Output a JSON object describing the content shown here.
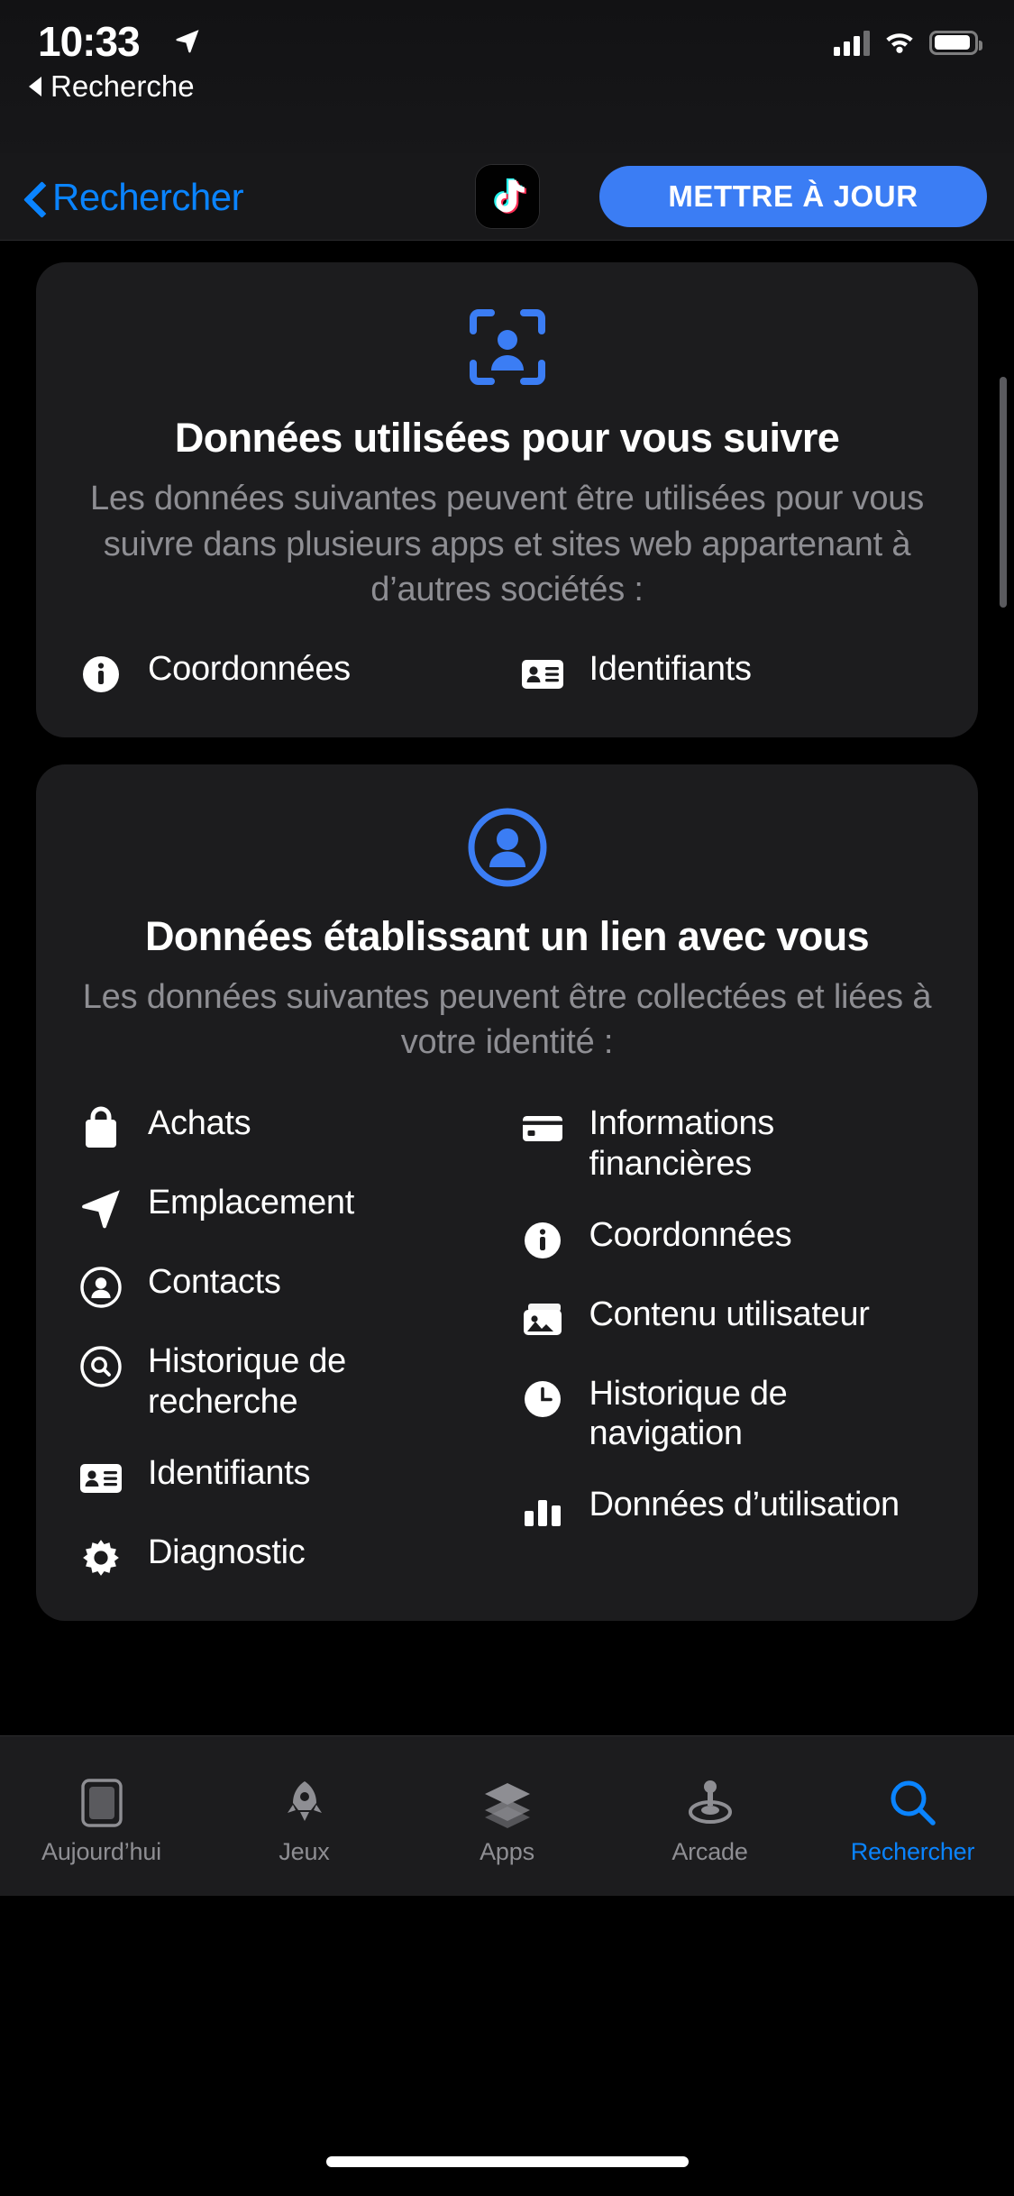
{
  "status_bar": {
    "time": "10:33",
    "location_icon": "location-arrow-icon",
    "cellular_icon": "cellular-signal-icon",
    "wifi_icon": "wifi-icon",
    "battery_icon": "battery-icon",
    "back_to_app_label": "Recherche"
  },
  "nav": {
    "back_label": "Rechercher",
    "app_icon": "tiktok-app-icon",
    "update_label": "METTRE À JOUR",
    "accent_color": "#3b7df4"
  },
  "cards": [
    {
      "icon": "tracking-face-frame-icon",
      "icon_color": "#3b7df4",
      "title": "Données utilisées pour vous suivre",
      "subtitle": "Les données suivantes peuvent être utilisées pour vous suivre dans plusieurs apps et sites web appartenant à d’autres sociétés :",
      "left_items": [
        {
          "icon": "info-circle-icon",
          "label": "Coordonnées"
        }
      ],
      "right_items": [
        {
          "icon": "id-card-icon",
          "label": "Identifiants"
        }
      ]
    },
    {
      "icon": "person-circle-icon",
      "icon_color": "#3b7df4",
      "title": "Données établissant un lien avec vous",
      "subtitle": "Les données suivantes peuvent être collectées et liées à votre identité :",
      "left_items": [
        {
          "icon": "shopping-bag-icon",
          "label": "Achats"
        },
        {
          "icon": "location-arrow-icon",
          "label": "Emplacement"
        },
        {
          "icon": "contacts-person-circle-icon",
          "label": "Contacts"
        },
        {
          "icon": "magnifier-circle-icon",
          "label": "Historique de recherche"
        },
        {
          "icon": "id-card-icon",
          "label": "Identifiants"
        },
        {
          "icon": "gear-icon",
          "label": "Diagnostic"
        }
      ],
      "right_items": [
        {
          "icon": "credit-card-icon",
          "label": "Informations financières"
        },
        {
          "icon": "info-circle-icon",
          "label": "Coordonnées"
        },
        {
          "icon": "photo-stack-icon",
          "label": "Contenu utilisateur"
        },
        {
          "icon": "clock-icon",
          "label": "Historique de navigation"
        },
        {
          "icon": "bar-chart-icon",
          "label": "Données d’utilisation"
        }
      ]
    }
  ],
  "tabbar": {
    "items": [
      {
        "icon": "today-icon",
        "label": "Aujourd’hui",
        "active": false
      },
      {
        "icon": "games-rocket-icon",
        "label": "Jeux",
        "active": false
      },
      {
        "icon": "apps-stack-icon",
        "label": "Apps",
        "active": false
      },
      {
        "icon": "arcade-joystick-icon",
        "label": "Arcade",
        "active": false
      },
      {
        "icon": "search-icon",
        "label": "Rechercher",
        "active": true
      }
    ],
    "active_color": "#0a84ff",
    "inactive_color": "#8e8e93"
  }
}
